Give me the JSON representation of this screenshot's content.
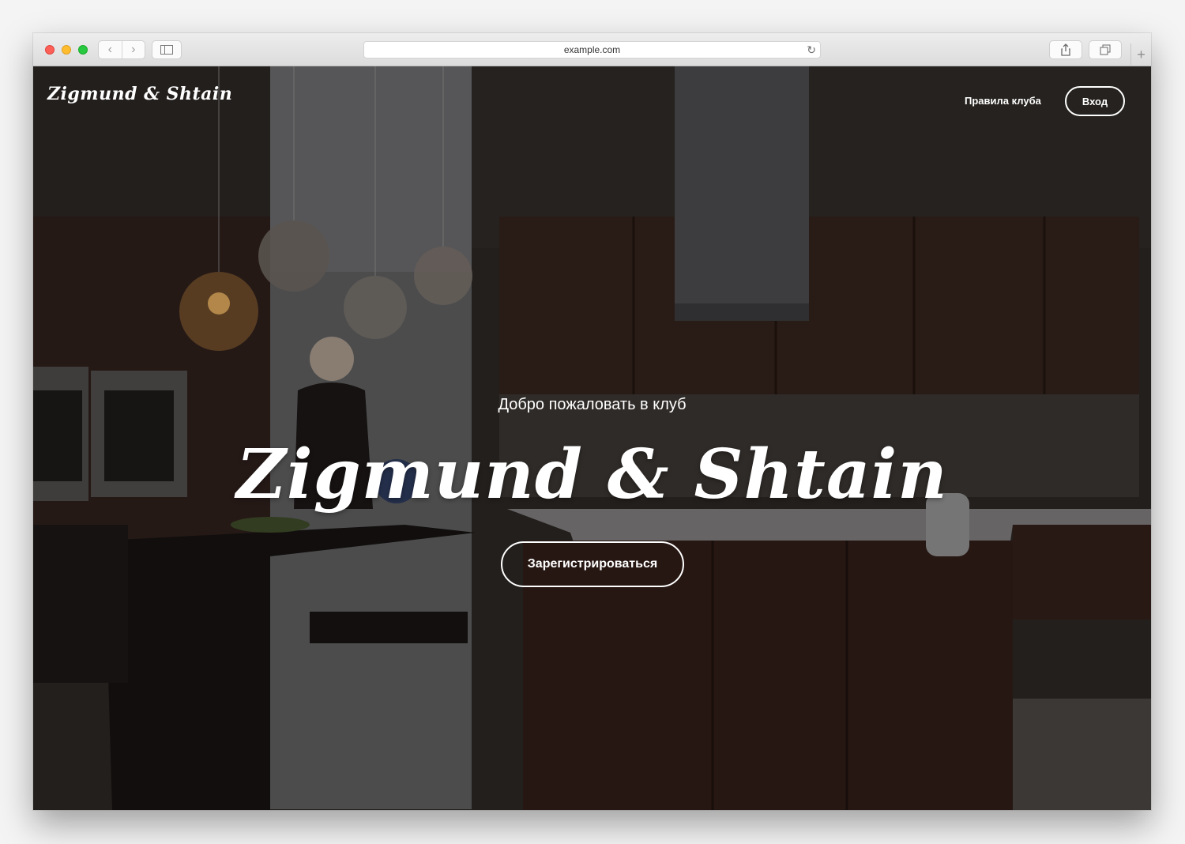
{
  "browser": {
    "url": "example.com",
    "back_icon": "chevron-left-icon",
    "forward_icon": "chevron-right-icon",
    "sidebar_icon": "sidebar-icon",
    "share_icon": "share-icon",
    "tabs_icon": "tabs-icon",
    "new_tab_icon": "plus-icon",
    "reload_icon": "reload-icon"
  },
  "header": {
    "logo": "Zigmund & Shtain",
    "nav_rules": "Правила клуба",
    "login": "Вход"
  },
  "hero": {
    "welcome": "Добро пожаловать в клуб",
    "brand": "Zigmund & Shtain",
    "register": "Зарегистрироваться"
  },
  "colors": {
    "overlay": "#000000",
    "text": "#ffffff",
    "cabinets": "#3a2620"
  }
}
